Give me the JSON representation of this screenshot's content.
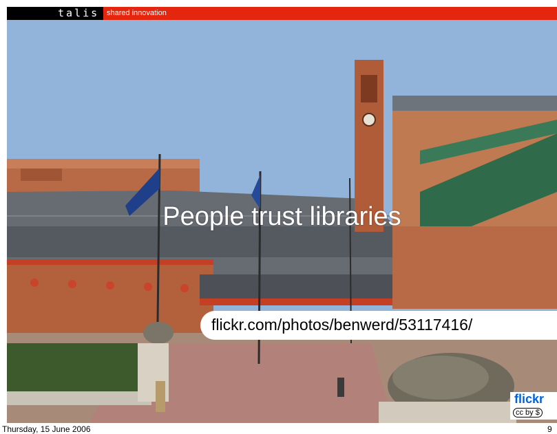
{
  "banner": {
    "logo": "talis",
    "tagline": "shared innovation"
  },
  "slide": {
    "title": "People trust libraries",
    "credit": "flickr.com/photos/benwerd/53117416/",
    "badge_logo": "flickr",
    "badge_license": "cc by $"
  },
  "footer": {
    "date": "Thursday, 15 June 2006",
    "page": "9"
  },
  "colors": {
    "banner_red": "#e5260f",
    "sky_blue": "#8fb2d8",
    "brick": "#b86a46",
    "flickr_blue": "#0063dc"
  },
  "icons": [
    "flickr-logo-icon",
    "creative-commons-icon"
  ]
}
